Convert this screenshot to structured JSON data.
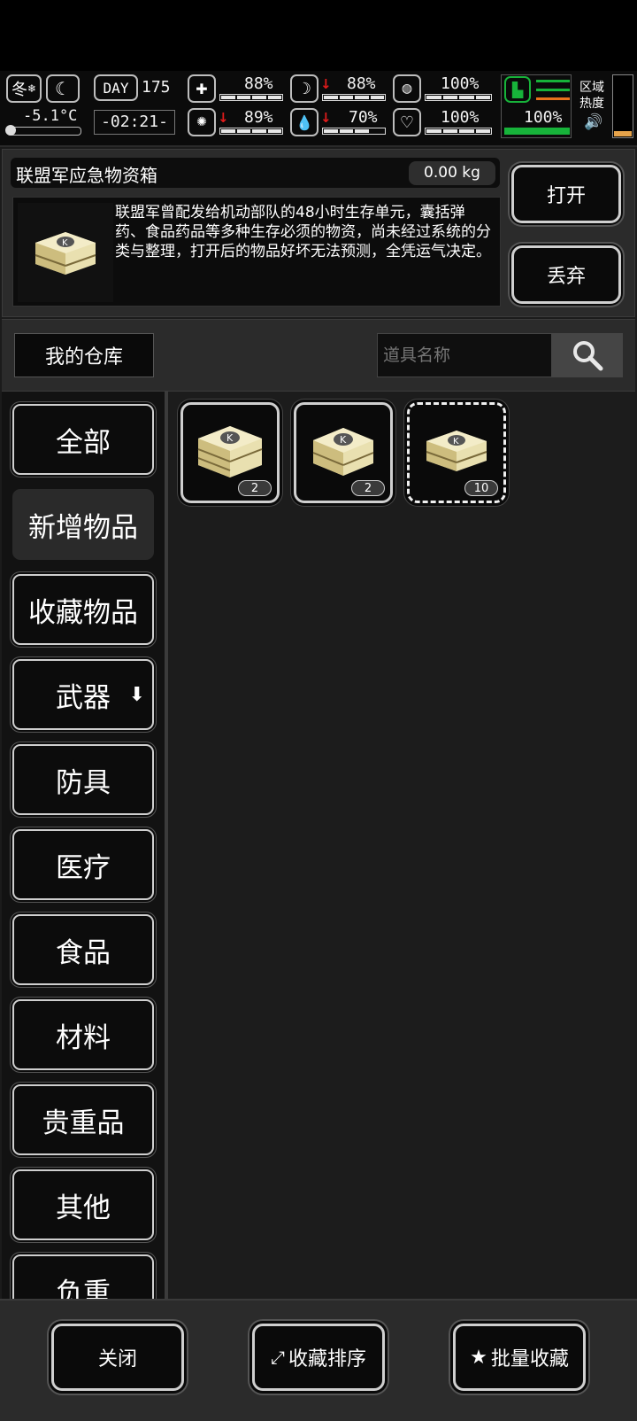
{
  "hud": {
    "season": "冬",
    "temperature": "-5.1°C",
    "day_label": "DAY",
    "day_number": "175",
    "clock": "-02:21-",
    "stats": [
      {
        "name": "health",
        "value": "88%",
        "level": 0.88,
        "falling": false
      },
      {
        "name": "sleep",
        "value": "88%",
        "level": 0.88,
        "falling": true
      },
      {
        "name": "stomach",
        "value": "100%",
        "level": 1.0,
        "falling": false
      },
      {
        "name": "mental",
        "value": "89%",
        "level": 0.89,
        "falling": true
      },
      {
        "name": "water",
        "value": "70%",
        "level": 0.7,
        "falling": true
      },
      {
        "name": "heart",
        "value": "100%",
        "level": 1.0,
        "falling": false
      }
    ],
    "boot_value": "100%",
    "zone_heat_label": "区域\n热度",
    "colors": {
      "accent_green": "#17b33a",
      "orange": "#e8721c"
    }
  },
  "selected_item": {
    "name": "联盟军应急物资箱",
    "weight": "0.00 kg",
    "description": "联盟军曾配发给机动部队的48小时生存单元，囊括弹药、食品药品等多种生存必须的物资，尚未经过系统的分类与整理，打开后的物品好坏无法预测，全凭运气决定。",
    "open_label": "打开",
    "discard_label": "丢弃"
  },
  "warehouse": {
    "title": "我的仓库",
    "search_placeholder": "道具名称"
  },
  "categories": [
    "全部",
    "新增物品",
    "收藏物品",
    "武器",
    "防具",
    "医疗",
    "食品",
    "材料",
    "贵重品",
    "其他",
    "负重"
  ],
  "selected_category": "新增物品",
  "items": [
    {
      "name": "supply-crate-large",
      "count": "2"
    },
    {
      "name": "supply-crate-medium",
      "count": "2"
    },
    {
      "name": "supply-crate-small",
      "count": "10",
      "selected": true
    }
  ],
  "footer": {
    "close_label": "关闭",
    "sort_label": "收藏排序",
    "batch_label": "批量收藏"
  }
}
